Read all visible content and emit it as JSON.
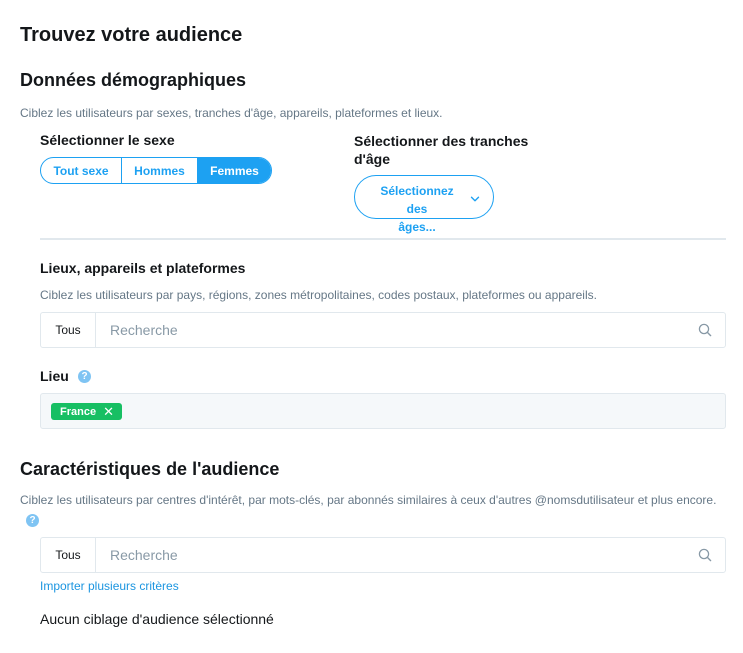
{
  "page": {
    "title": "Trouvez votre audience"
  },
  "demographics": {
    "title": "Données démographiques",
    "description": "Ciblez les utilisateurs par sexes, tranches d'âge, appareils, plateformes et lieux.",
    "gender": {
      "label": "Sélectionner le sexe",
      "options": [
        "Tout sexe",
        "Hommes",
        "Femmes"
      ],
      "selected": "Femmes"
    },
    "age": {
      "label_line1": "Sélectionner des tranches",
      "label_line2": "d'âge",
      "dropdown_line1": "Sélectionnez des",
      "dropdown_line2": "âges..."
    },
    "locations": {
      "title": "Lieux, appareils et plateformes",
      "description": "Ciblez les utilisateurs par pays, régions, zones métropolitaines, codes postaux, plateformes ou appareils.",
      "scope": "Tous",
      "placeholder": "Recherche",
      "lieu_label": "Lieu",
      "help_glyph": "?",
      "tags": [
        {
          "label": "France",
          "remove_glyph": "✕"
        }
      ]
    }
  },
  "audience": {
    "title": "Caractéristiques de l'audience",
    "description": "Ciblez les utilisateurs par centres d'intérêt, par mots-clés, par abonnés similaires à ceux d'autres @nomsdutilisateur et plus encore.",
    "help_glyph": "?",
    "scope": "Tous",
    "placeholder": "Recherche",
    "import_link": "Importer plusieurs critères",
    "empty_text": "Aucun ciblage d'audience sélectionné"
  },
  "colors": {
    "accent": "#1da1f2",
    "tag_green": "#17bf63",
    "muted": "#657786",
    "border": "#e1e8ed"
  }
}
